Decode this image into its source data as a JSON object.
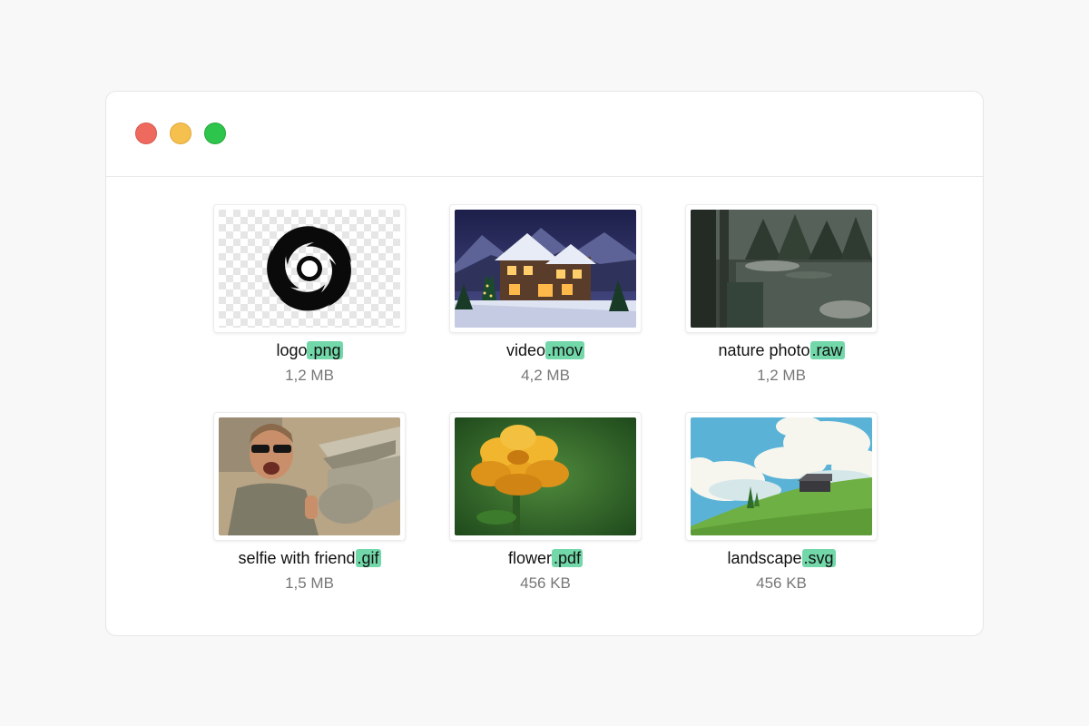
{
  "theme": {
    "background": "#f8f8f8",
    "window": "#ffffff",
    "extension_highlight": "#72d8a9",
    "traffic_lights": {
      "close": "#ee6a5f",
      "minimize": "#f6c04f",
      "maximize": "#2ec54c"
    }
  },
  "files": [
    {
      "name": "logo",
      "ext": ".png",
      "size": "1,2 MB",
      "thumbnail": "spiral-logo-image"
    },
    {
      "name": "video",
      "ext": ".mov",
      "size": "4,2 MB",
      "thumbnail": "snowy-house-image"
    },
    {
      "name": "nature photo",
      "ext": ".raw",
      "size": "1,2 MB",
      "thumbnail": "forest-lake-image"
    },
    {
      "name": "selfie with friend",
      "ext": ".gif",
      "size": "1,5 MB",
      "thumbnail": "selfie-crocodile-image"
    },
    {
      "name": "flower",
      "ext": ".pdf",
      "size": "456 KB",
      "thumbnail": "marigold-flower-image"
    },
    {
      "name": "landscape",
      "ext": ".svg",
      "size": "456 KB",
      "thumbnail": "hill-landscape-image"
    }
  ]
}
